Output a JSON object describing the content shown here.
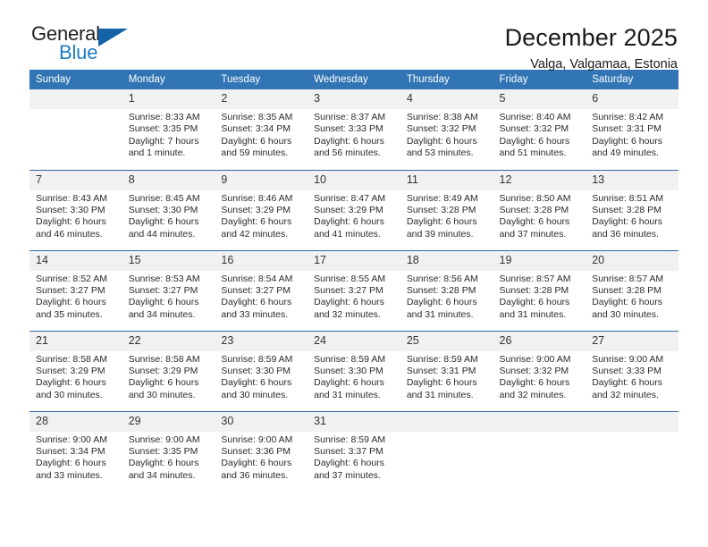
{
  "brand": {
    "name_top": "General",
    "name_bottom": "Blue",
    "triangle_color": "#1462a8",
    "blue_text_color": "#1d7cc4"
  },
  "header": {
    "title": "December 2025",
    "subtitle": "Valga, Valgamaa, Estonia"
  },
  "theme": {
    "header_blue": "#3175b4",
    "row_divider_blue": "#2f6aa8",
    "daynum_background": "#f1f1f1"
  },
  "weekdays": [
    "Sunday",
    "Monday",
    "Tuesday",
    "Wednesday",
    "Thursday",
    "Friday",
    "Saturday"
  ],
  "weeks": [
    [
      {
        "day": "",
        "l1": "",
        "l2": "",
        "l3": "",
        "l4": ""
      },
      {
        "day": "1",
        "l1": "Sunrise: 8:33 AM",
        "l2": "Sunset: 3:35 PM",
        "l3": "Daylight: 7 hours",
        "l4": "and 1 minute."
      },
      {
        "day": "2",
        "l1": "Sunrise: 8:35 AM",
        "l2": "Sunset: 3:34 PM",
        "l3": "Daylight: 6 hours",
        "l4": "and 59 minutes."
      },
      {
        "day": "3",
        "l1": "Sunrise: 8:37 AM",
        "l2": "Sunset: 3:33 PM",
        "l3": "Daylight: 6 hours",
        "l4": "and 56 minutes."
      },
      {
        "day": "4",
        "l1": "Sunrise: 8:38 AM",
        "l2": "Sunset: 3:32 PM",
        "l3": "Daylight: 6 hours",
        "l4": "and 53 minutes."
      },
      {
        "day": "5",
        "l1": "Sunrise: 8:40 AM",
        "l2": "Sunset: 3:32 PM",
        "l3": "Daylight: 6 hours",
        "l4": "and 51 minutes."
      },
      {
        "day": "6",
        "l1": "Sunrise: 8:42 AM",
        "l2": "Sunset: 3:31 PM",
        "l3": "Daylight: 6 hours",
        "l4": "and 49 minutes."
      }
    ],
    [
      {
        "day": "7",
        "l1": "Sunrise: 8:43 AM",
        "l2": "Sunset: 3:30 PM",
        "l3": "Daylight: 6 hours",
        "l4": "and 46 minutes."
      },
      {
        "day": "8",
        "l1": "Sunrise: 8:45 AM",
        "l2": "Sunset: 3:30 PM",
        "l3": "Daylight: 6 hours",
        "l4": "and 44 minutes."
      },
      {
        "day": "9",
        "l1": "Sunrise: 8:46 AM",
        "l2": "Sunset: 3:29 PM",
        "l3": "Daylight: 6 hours",
        "l4": "and 42 minutes."
      },
      {
        "day": "10",
        "l1": "Sunrise: 8:47 AM",
        "l2": "Sunset: 3:29 PM",
        "l3": "Daylight: 6 hours",
        "l4": "and 41 minutes."
      },
      {
        "day": "11",
        "l1": "Sunrise: 8:49 AM",
        "l2": "Sunset: 3:28 PM",
        "l3": "Daylight: 6 hours",
        "l4": "and 39 minutes."
      },
      {
        "day": "12",
        "l1": "Sunrise: 8:50 AM",
        "l2": "Sunset: 3:28 PM",
        "l3": "Daylight: 6 hours",
        "l4": "and 37 minutes."
      },
      {
        "day": "13",
        "l1": "Sunrise: 8:51 AM",
        "l2": "Sunset: 3:28 PM",
        "l3": "Daylight: 6 hours",
        "l4": "and 36 minutes."
      }
    ],
    [
      {
        "day": "14",
        "l1": "Sunrise: 8:52 AM",
        "l2": "Sunset: 3:27 PM",
        "l3": "Daylight: 6 hours",
        "l4": "and 35 minutes."
      },
      {
        "day": "15",
        "l1": "Sunrise: 8:53 AM",
        "l2": "Sunset: 3:27 PM",
        "l3": "Daylight: 6 hours",
        "l4": "and 34 minutes."
      },
      {
        "day": "16",
        "l1": "Sunrise: 8:54 AM",
        "l2": "Sunset: 3:27 PM",
        "l3": "Daylight: 6 hours",
        "l4": "and 33 minutes."
      },
      {
        "day": "17",
        "l1": "Sunrise: 8:55 AM",
        "l2": "Sunset: 3:27 PM",
        "l3": "Daylight: 6 hours",
        "l4": "and 32 minutes."
      },
      {
        "day": "18",
        "l1": "Sunrise: 8:56 AM",
        "l2": "Sunset: 3:28 PM",
        "l3": "Daylight: 6 hours",
        "l4": "and 31 minutes."
      },
      {
        "day": "19",
        "l1": "Sunrise: 8:57 AM",
        "l2": "Sunset: 3:28 PM",
        "l3": "Daylight: 6 hours",
        "l4": "and 31 minutes."
      },
      {
        "day": "20",
        "l1": "Sunrise: 8:57 AM",
        "l2": "Sunset: 3:28 PM",
        "l3": "Daylight: 6 hours",
        "l4": "and 30 minutes."
      }
    ],
    [
      {
        "day": "21",
        "l1": "Sunrise: 8:58 AM",
        "l2": "Sunset: 3:29 PM",
        "l3": "Daylight: 6 hours",
        "l4": "and 30 minutes."
      },
      {
        "day": "22",
        "l1": "Sunrise: 8:58 AM",
        "l2": "Sunset: 3:29 PM",
        "l3": "Daylight: 6 hours",
        "l4": "and 30 minutes."
      },
      {
        "day": "23",
        "l1": "Sunrise: 8:59 AM",
        "l2": "Sunset: 3:30 PM",
        "l3": "Daylight: 6 hours",
        "l4": "and 30 minutes."
      },
      {
        "day": "24",
        "l1": "Sunrise: 8:59 AM",
        "l2": "Sunset: 3:30 PM",
        "l3": "Daylight: 6 hours",
        "l4": "and 31 minutes."
      },
      {
        "day": "25",
        "l1": "Sunrise: 8:59 AM",
        "l2": "Sunset: 3:31 PM",
        "l3": "Daylight: 6 hours",
        "l4": "and 31 minutes."
      },
      {
        "day": "26",
        "l1": "Sunrise: 9:00 AM",
        "l2": "Sunset: 3:32 PM",
        "l3": "Daylight: 6 hours",
        "l4": "and 32 minutes."
      },
      {
        "day": "27",
        "l1": "Sunrise: 9:00 AM",
        "l2": "Sunset: 3:33 PM",
        "l3": "Daylight: 6 hours",
        "l4": "and 32 minutes."
      }
    ],
    [
      {
        "day": "28",
        "l1": "Sunrise: 9:00 AM",
        "l2": "Sunset: 3:34 PM",
        "l3": "Daylight: 6 hours",
        "l4": "and 33 minutes."
      },
      {
        "day": "29",
        "l1": "Sunrise: 9:00 AM",
        "l2": "Sunset: 3:35 PM",
        "l3": "Daylight: 6 hours",
        "l4": "and 34 minutes."
      },
      {
        "day": "30",
        "l1": "Sunrise: 9:00 AM",
        "l2": "Sunset: 3:36 PM",
        "l3": "Daylight: 6 hours",
        "l4": "and 36 minutes."
      },
      {
        "day": "31",
        "l1": "Sunrise: 8:59 AM",
        "l2": "Sunset: 3:37 PM",
        "l3": "Daylight: 6 hours",
        "l4": "and 37 minutes."
      },
      {
        "day": "",
        "l1": "",
        "l2": "",
        "l3": "",
        "l4": ""
      },
      {
        "day": "",
        "l1": "",
        "l2": "",
        "l3": "",
        "l4": ""
      },
      {
        "day": "",
        "l1": "",
        "l2": "",
        "l3": "",
        "l4": ""
      }
    ]
  ]
}
